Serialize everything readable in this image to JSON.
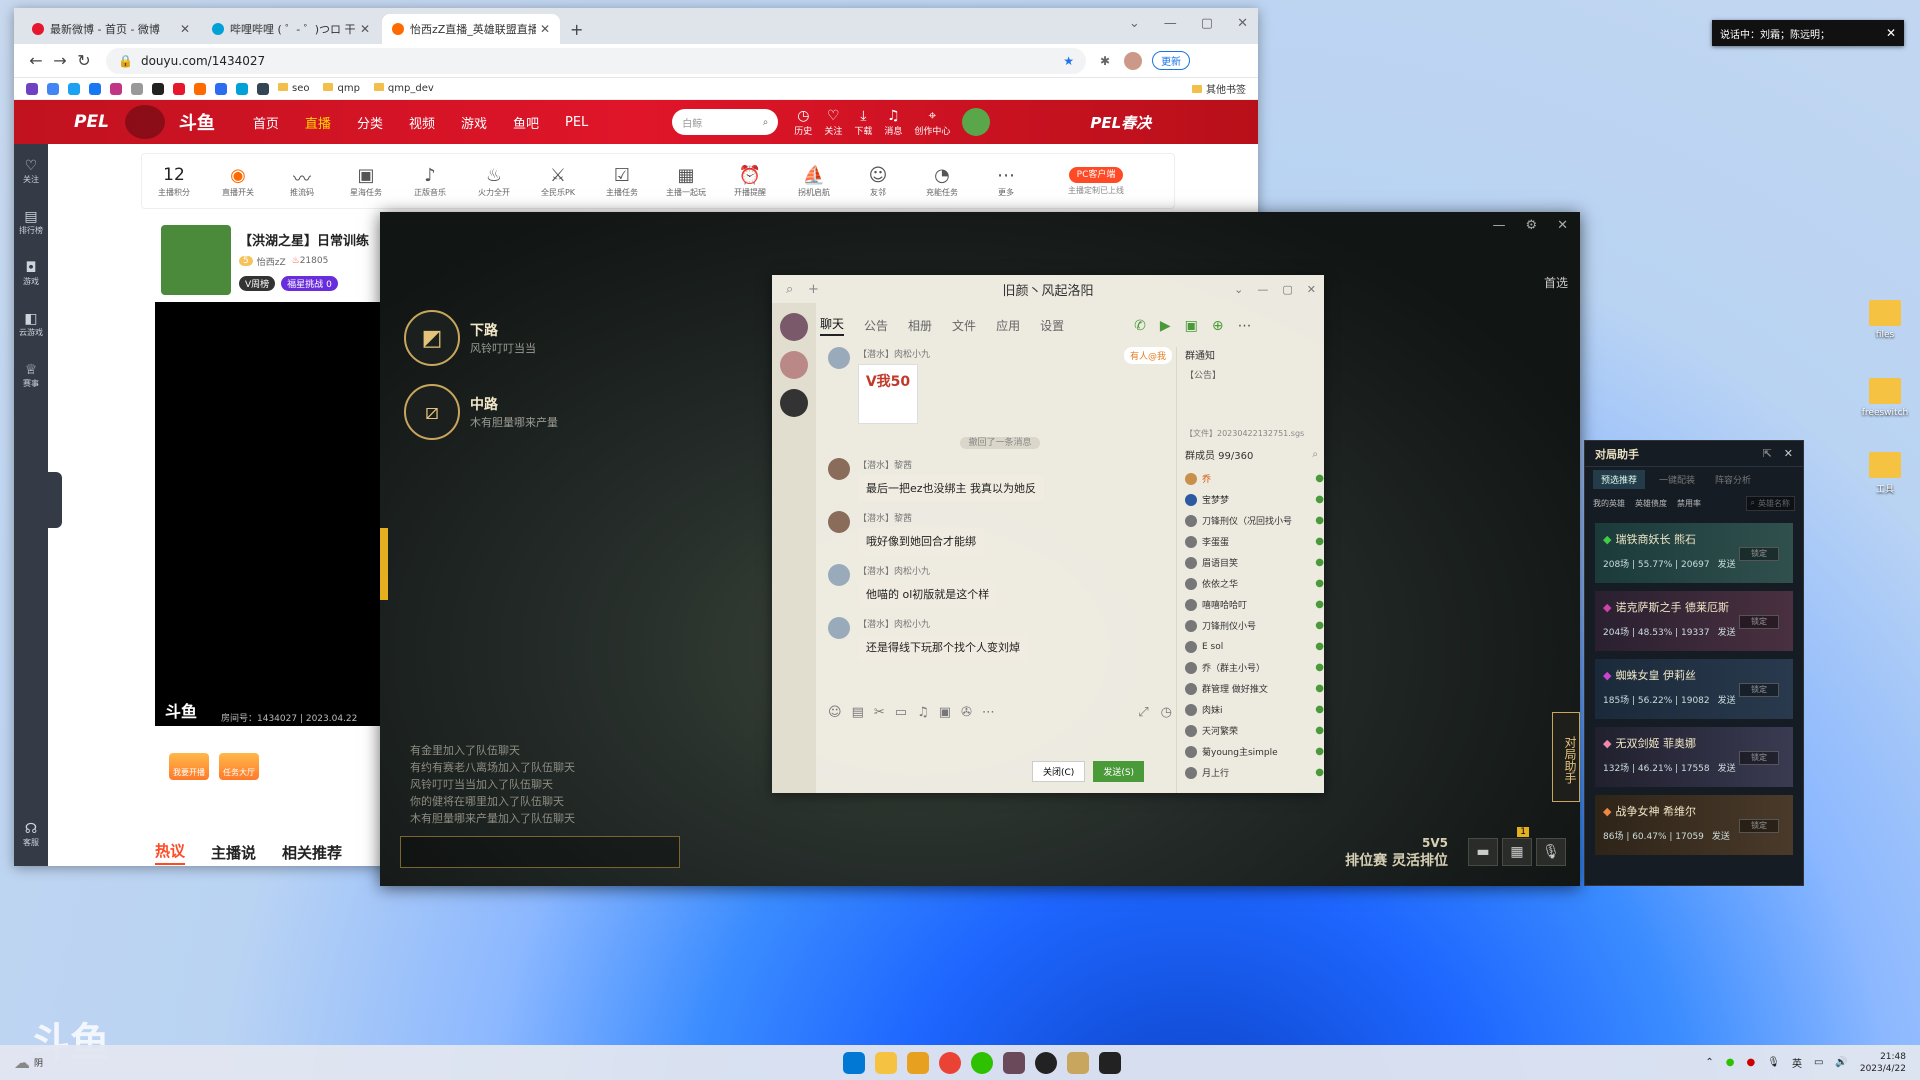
{
  "browser": {
    "tabs": [
      {
        "label": "最新微博 - 首页 - 微博",
        "color": "#e6162d"
      },
      {
        "label": "哔哩哔哩 ( ゜- ゜)つロ 干杯~-bili",
        "color": "#00a1d6"
      },
      {
        "label": "怡西zZ直播_英雄联盟直播_斗鱼",
        "color": "#ff6a00"
      }
    ],
    "new_tab": "+",
    "url": "douyu.com/1434027",
    "update_label": "更新",
    "bookmarks": [
      "seo",
      "qmp",
      "qmp_dev"
    ],
    "other_bookmarks": "其他书签"
  },
  "site": {
    "logo": "斗鱼",
    "pel": "PEL",
    "nav": [
      "首页",
      "直播",
      "分类",
      "视频",
      "游戏",
      "鱼吧",
      "PEL"
    ],
    "search_placeholder": "白鲸",
    "header_icons": [
      "历史",
      "关注",
      "下载",
      "消息",
      "创作中心"
    ],
    "promo": "PEL春决"
  },
  "left_bar": [
    "关注",
    "排行榜",
    "游戏",
    "云游戏",
    "赛事",
    "客服"
  ],
  "tools": {
    "score_value": "12",
    "score_label": "主播积分",
    "items": [
      "直播开关",
      "推流码",
      "星海任务",
      "正版音乐",
      "火力全开",
      "全民乐PK",
      "主播任务",
      "主播一起玩",
      "开播提醒",
      "拐机启航",
      "友邻",
      "充能任务",
      "更多"
    ],
    "pc_btn": "PC客户端",
    "pc_sub": "主播定制已上线"
  },
  "stream": {
    "title": "【洪湖之星】日常训练",
    "name": "怡西zZ",
    "level": "5",
    "heat": "21805",
    "tag1": "V周榜",
    "tag2": "福星挑战",
    "tag2_count": "0",
    "room_info": "房间号：1434027 | 2023.04.22",
    "watermark": "斗鱼",
    "footer_btns": [
      "我要开播",
      "任务大厅"
    ],
    "bottom_tabs": [
      "热议",
      "主播说",
      "相关推荐"
    ]
  },
  "game": {
    "lanes": [
      {
        "name": "下路",
        "sub": "风铃叮叮当当"
      },
      {
        "name": "中路",
        "sub": "木有胆量哪来产量"
      }
    ],
    "first_choice": "首选",
    "log": [
      "有金里加入了队伍聊天",
      "有约有赛老八离场加入了队伍聊天",
      "风铃叮叮当当加入了队伍聊天",
      "你的健将在哪里加入了队伍聊天",
      "木有胆量哪来产量加入了队伍聊天"
    ],
    "mode_top": "5V5",
    "mode_bottom": "排位赛 灵活排位",
    "badge": "1",
    "side_tab": "对局助手"
  },
  "qq": {
    "title": "旧颜丶风起洛阳",
    "tabs": [
      "聊天",
      "公告",
      "相册",
      "文件",
      "应用",
      "设置"
    ],
    "sticker_text": "V我50",
    "mention": "有人@我",
    "system_msg": "撤回了一条消息",
    "messages": [
      {
        "from": "【潜水】肉松小九",
        "text": ""
      },
      {
        "from": "【潜水】黎茜",
        "text": "最后一把ez也没绑主  我真以为她反"
      },
      {
        "from": "【潜水】黎茜",
        "text": "哦好像到她回合才能绑"
      },
      {
        "from": "【潜水】肉松小九",
        "text": "他喵的 ol初版就是这个样"
      },
      {
        "from": "【潜水】肉松小九",
        "text": "还是得线下玩那个找个人变刘焯"
      }
    ],
    "notice_title": "群通知",
    "notice_body": "【公告】",
    "file": "【文件】20230422132751.sgs",
    "member_count": "群成员 99/360",
    "members": [
      "乔",
      "宝梦梦",
      "刀锋刑仪（况回找小号",
      "李蛋蛋",
      "眉语目笑",
      "依依之华",
      "嘻嘻哈哈叮",
      "刀锋刑仪小号",
      "E sol",
      "乔（群主小号）",
      "群管理 做好推文",
      "肉妹i",
      "天河繁荣",
      "菊young主simple",
      "月上行"
    ],
    "close_btn": "关闭(C)",
    "send_btn": "发送(S)"
  },
  "assist": {
    "title": "对局助手",
    "tabs": [
      "预选推荐",
      "一键配装",
      "阵容分析"
    ],
    "sub_tabs": [
      "我的英雄",
      "英雄债度",
      "禁用率"
    ],
    "search_placeholder": "英雄名称",
    "heroes": [
      {
        "name": "瑞铁商妖长 熊石",
        "stats": "208场 | 55.77% | 20697",
        "send": "发送"
      },
      {
        "name": "诺克萨斯之手 德莱厄斯",
        "stats": "204场 | 48.53% | 19337",
        "send": "发送"
      },
      {
        "name": "蜘蛛女皇 伊莉丝",
        "stats": "185场 | 56.22% | 19082",
        "send": "发送"
      },
      {
        "name": "无双剑姬 菲奥娜",
        "stats": "132场 | 46.21% | 17558",
        "send": "发送"
      },
      {
        "name": "战争女神 希维尔",
        "stats": "86场 | 60.47% | 17059",
        "send": "发送"
      }
    ],
    "hero_btn": "锁定"
  },
  "voice": {
    "text": "说话中：刘霜；陈远明；"
  },
  "desktop": [
    "files",
    "freeswitch",
    "工具"
  ],
  "taskbar": {
    "weather": "阴",
    "lang": "英",
    "time": "21:48",
    "date": "2023/4/22"
  }
}
